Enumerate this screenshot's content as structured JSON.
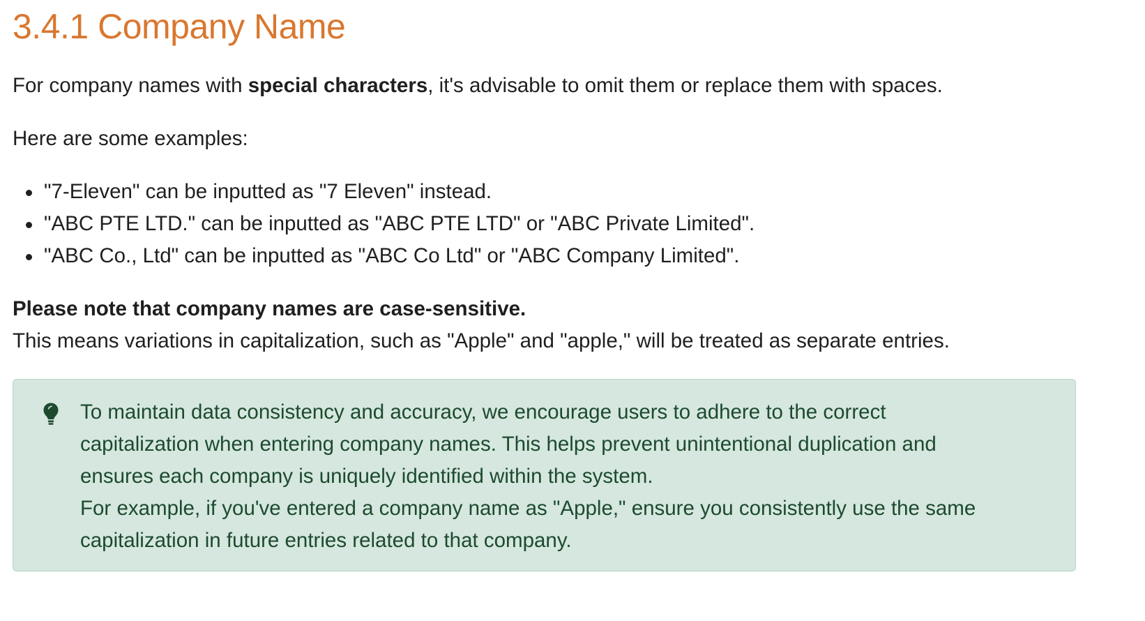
{
  "heading": "3.4.1 Company Name",
  "intro": {
    "before": "For company names with ",
    "bold": "special characters",
    "after": ", it's advisable to omit them or replace them with spaces."
  },
  "examples_intro": "Here are some examples:",
  "examples": [
    "\"7-Eleven\" can be inputted as \"7 Eleven\" instead.",
    "\"ABC PTE LTD.\" can be inputted as \"ABC PTE LTD\" or \"ABC Private Limited\".",
    "\"ABC Co., Ltd\" can be inputted as \"ABC Co Ltd\" or \"ABC Company Limited\"."
  ],
  "note": {
    "bold": "Please note that company names are case-sensitive.",
    "text": "This means variations in capitalization, such as \"Apple\" and \"apple,\" will be treated as separate entries."
  },
  "callout": {
    "icon": "lightbulb-icon",
    "lines": [
      "To maintain data consistency and accuracy, we encourage users to adhere to the correct",
      "capitalization when entering company names. This helps prevent unintentional duplication and",
      "ensures each company is uniquely identified within the system.",
      "For example, if you've entered a company name as \"Apple,\" ensure you consistently use the same",
      "capitalization in future entries related to that company."
    ]
  },
  "colors": {
    "heading": "#d9772f",
    "callout_background": "#d5e7de",
    "callout_border": "#b9d6c7",
    "callout_text": "#1d4a2f"
  }
}
